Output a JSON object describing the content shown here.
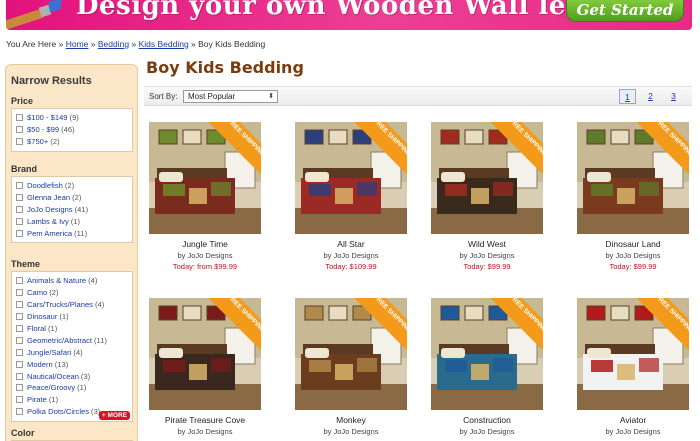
{
  "banner": {
    "headline": "Design your own Wooden Wall letters",
    "cta": "Get Started >>"
  },
  "breadcrumb": {
    "prefix": "You Are Here »",
    "home": "Home",
    "sep": "»",
    "bedding": "Bedding",
    "kids": "Kids Bedding",
    "current": "» Boy Kids Bedding"
  },
  "sidebar": {
    "title": "Narrow Results",
    "facets": [
      {
        "title": "Price",
        "options": [
          {
            "label": "$100 - $149",
            "count": "(9)"
          },
          {
            "label": "$50 - $99",
            "count": "(46)"
          },
          {
            "label": "$750+",
            "count": "(2)"
          }
        ]
      },
      {
        "title": "Brand",
        "options": [
          {
            "label": "Doodlefish",
            "count": "(2)"
          },
          {
            "label": "Glenna Jean",
            "count": "(2)"
          },
          {
            "label": "JoJo Designs",
            "count": "(41)"
          },
          {
            "label": "Lambs & Ivy",
            "count": "(1)"
          },
          {
            "label": "Pem America",
            "count": "(11)"
          }
        ]
      },
      {
        "title": "Theme",
        "more": "+ MORE",
        "options": [
          {
            "label": "Animals & Nature",
            "count": "(4)"
          },
          {
            "label": "Camo",
            "count": "(2)"
          },
          {
            "label": "Cars/Trucks/Planes",
            "count": "(4)"
          },
          {
            "label": "Dinosaur",
            "count": "(1)"
          },
          {
            "label": "Floral",
            "count": "(1)"
          },
          {
            "label": "Geometric/Abstract",
            "count": "(11)"
          },
          {
            "label": "Jungle/Safari",
            "count": "(4)"
          },
          {
            "label": "Modern",
            "count": "(13)"
          },
          {
            "label": "Nautical/Ocean",
            "count": "(3)"
          },
          {
            "label": "Peace/Groovy",
            "count": "(1)"
          },
          {
            "label": "Pirate",
            "count": "(1)"
          },
          {
            "label": "Polka Dots/Circles",
            "count": "(3)"
          }
        ]
      },
      {
        "title": "Color",
        "options": []
      }
    ]
  },
  "main": {
    "title": "Boy Kids Bedding",
    "sort_label": "Sort By:",
    "sort_value": "Most Popular",
    "pages": [
      "1",
      "2",
      "3"
    ],
    "ribbon": "FREE SHIPPING",
    "products": [
      {
        "name": "Jungle Time",
        "brand": "by JoJo Designs",
        "price": "Today: from $99.99",
        "accent": "#6e8a2c",
        "quilt": "#7a2b1e"
      },
      {
        "name": "All Star",
        "brand": "by JoJo Designs",
        "price": "Today: $109.99",
        "accent": "#2b3f7c",
        "quilt": "#9b2a25"
      },
      {
        "name": "Wild West",
        "brand": "by JoJo Designs",
        "price": "Today: $99.99",
        "accent": "#a12b1f",
        "quilt": "#3a2a1e"
      },
      {
        "name": "Dinosaur Land",
        "brand": "by JoJo Designs",
        "price": "Today: $99.99",
        "accent": "#5e7a2a",
        "quilt": "#7a3a1e"
      },
      {
        "name": "Pirate Treasure Cove",
        "brand": "by JoJo Designs",
        "price": "",
        "accent": "#7a1a1a",
        "quilt": "#3a2820"
      },
      {
        "name": "Monkey",
        "brand": "by JoJo Designs",
        "price": "",
        "accent": "#b08a4a",
        "quilt": "#6b3d1e"
      },
      {
        "name": "Construction",
        "brand": "by JoJo Designs",
        "price": "",
        "accent": "#1f5a9a",
        "quilt": "#2a6a8a"
      },
      {
        "name": "Aviator",
        "brand": "by JoJo Designs",
        "price": "",
        "accent": "#b01a1a",
        "quilt": "#f2f2f2"
      }
    ]
  }
}
